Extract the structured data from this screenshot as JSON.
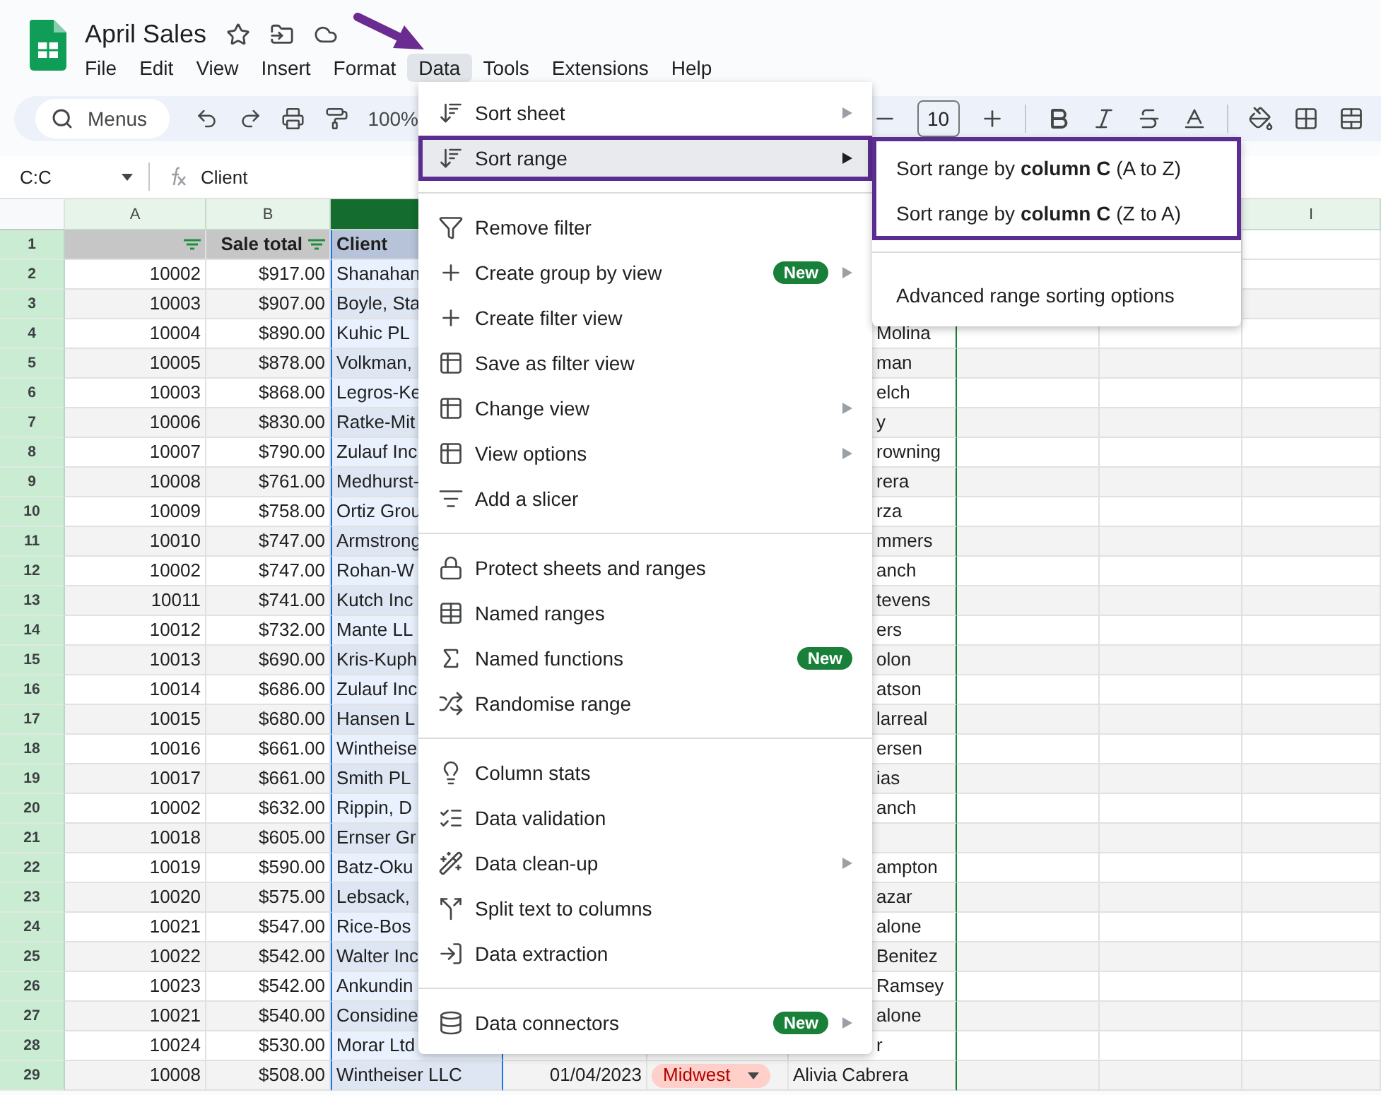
{
  "document": {
    "title": "April Sales"
  },
  "menubar": {
    "items": [
      {
        "label": "File",
        "selected": false
      },
      {
        "label": "Edit",
        "selected": false
      },
      {
        "label": "View",
        "selected": false
      },
      {
        "label": "Insert",
        "selected": false
      },
      {
        "label": "Format",
        "selected": false
      },
      {
        "label": "Data",
        "selected": true
      },
      {
        "label": "Tools",
        "selected": false
      },
      {
        "label": "Extensions",
        "selected": false
      },
      {
        "label": "Help",
        "selected": false
      }
    ]
  },
  "toolbar": {
    "search": {
      "placeholder": "Menus"
    },
    "zoom": "100%",
    "font_size": "10"
  },
  "formula_bar": {
    "name_box": "C:C",
    "content": "Client"
  },
  "sheet": {
    "column_headers": [
      {
        "label": "A",
        "selected": false
      },
      {
        "label": "B",
        "selected": false
      },
      {
        "selected": true
      },
      {
        "label": "I",
        "selected": false
      }
    ],
    "header_row": {
      "number": "1",
      "cells": [
        {
          "filter": true
        },
        {
          "text": "Sale total",
          "filter": true
        },
        {
          "text": "Client",
          "filter": false
        }
      ]
    },
    "rows": [
      {
        "number": "2",
        "a": "10002",
        "b": "$917.00",
        "c": "Shanahan"
      },
      {
        "number": "3",
        "a": "10003",
        "b": "$907.00",
        "c": "Boyle, Sta"
      },
      {
        "number": "4",
        "a": "10004",
        "b": "$890.00",
        "c": "Kuhic PL",
        "f_visible": "Molina"
      },
      {
        "number": "5",
        "a": "10005",
        "b": "$878.00",
        "c": "Volkman,",
        "f_visible": "man"
      },
      {
        "number": "6",
        "a": "10003",
        "b": "$868.00",
        "c": "Legros-Ke",
        "f_visible": "elch"
      },
      {
        "number": "7",
        "a": "10006",
        "b": "$830.00",
        "c": "Ratke-Mit",
        "f_visible": "y"
      },
      {
        "number": "8",
        "a": "10007",
        "b": "$790.00",
        "c": "Zulauf Inc",
        "f_visible": "rowning"
      },
      {
        "number": "9",
        "a": "10008",
        "b": "$761.00",
        "c": "Medhurst-",
        "f_visible": "rera"
      },
      {
        "number": "10",
        "a": "10009",
        "b": "$758.00",
        "c": "Ortiz Grou",
        "f_visible": "rza"
      },
      {
        "number": "11",
        "a": "10010",
        "b": "$747.00",
        "c": "Armstrong",
        "f_visible": "mmers"
      },
      {
        "number": "12",
        "a": "10002",
        "b": "$747.00",
        "c": "Rohan-W",
        "f_visible": "anch"
      },
      {
        "number": "13",
        "a": "10011",
        "b": "$741.00",
        "c": "Kutch Inc",
        "f_visible": "tevens"
      },
      {
        "number": "14",
        "a": "10012",
        "b": "$732.00",
        "c": "Mante LL",
        "f_visible": "ers"
      },
      {
        "number": "15",
        "a": "10013",
        "b": "$690.00",
        "c": "Kris-Kuph",
        "f_visible": "olon"
      },
      {
        "number": "16",
        "a": "10014",
        "b": "$686.00",
        "c": "Zulauf Inc",
        "f_visible": "atson"
      },
      {
        "number": "17",
        "a": "10015",
        "b": "$680.00",
        "c": "Hansen L",
        "f_visible": "larreal"
      },
      {
        "number": "18",
        "a": "10016",
        "b": "$661.00",
        "c": "Wintheise",
        "f_visible": "ersen"
      },
      {
        "number": "19",
        "a": "10017",
        "b": "$661.00",
        "c": "Smith PL",
        "f_visible": "ias"
      },
      {
        "number": "20",
        "a": "10002",
        "b": "$632.00",
        "c": "Rippin, D",
        "f_visible": "anch"
      },
      {
        "number": "21",
        "a": "10018",
        "b": "$605.00",
        "c": "Ernser Gr"
      },
      {
        "number": "22",
        "a": "10019",
        "b": "$590.00",
        "c": "Batz-Oku",
        "f_visible": "ampton"
      },
      {
        "number": "23",
        "a": "10020",
        "b": "$575.00",
        "c": "Lebsack,",
        "f_visible": "azar"
      },
      {
        "number": "24",
        "a": "10021",
        "b": "$547.00",
        "c": "Rice-Bos",
        "f_visible": "alone"
      },
      {
        "number": "25",
        "a": "10022",
        "b": "$542.00",
        "c": "Walter Inc",
        "f_visible": "Benitez"
      },
      {
        "number": "26",
        "a": "10023",
        "b": "$542.00",
        "c": "Ankundin",
        "f_visible": "Ramsey"
      },
      {
        "number": "27",
        "a": "10021",
        "b": "$540.00",
        "c": "Considine",
        "f_visible": "alone"
      },
      {
        "number": "28",
        "a": "10024",
        "b": "$530.00",
        "c": "Morar Ltd",
        "f_visible": "r"
      },
      {
        "number": "29",
        "a": "10008",
        "b": "$508.00",
        "c": "Wintheiser LLC",
        "d": "01/04/2023",
        "e_chip": "Midwest",
        "f": "Alivia Cabrera"
      }
    ]
  },
  "menu": {
    "groups": [
      {
        "items": [
          {
            "label": "Sort sheet",
            "submenu": true,
            "selected": false,
            "annotated": false
          },
          {
            "label": "Sort range",
            "submenu": true,
            "selected": true,
            "annotated": true
          }
        ]
      },
      {
        "items": [
          {
            "label": "Remove filter",
            "submenu": false,
            "selected": false,
            "annotated": false
          },
          {
            "label": "Create group by view",
            "badge": "New",
            "submenu": true,
            "selected": false,
            "annotated": false
          },
          {
            "label": "Create filter view",
            "submenu": false,
            "selected": false,
            "annotated": false
          },
          {
            "label": "Save as filter view",
            "submenu": false,
            "selected": false,
            "annotated": false
          },
          {
            "label": "Change view",
            "submenu": true,
            "selected": false,
            "annotated": false
          },
          {
            "label": "View options",
            "submenu": true,
            "selected": false,
            "annotated": false
          },
          {
            "label": "Add a slicer",
            "submenu": false,
            "selected": false,
            "annotated": false
          }
        ]
      },
      {
        "items": [
          {
            "label": "Protect sheets and ranges",
            "submenu": false,
            "selected": false,
            "annotated": false
          },
          {
            "label": "Named ranges",
            "submenu": false,
            "selected": false,
            "annotated": false
          },
          {
            "label": "Named functions",
            "badge": "New",
            "submenu": false,
            "selected": false,
            "annotated": false
          },
          {
            "label": "Randomise range",
            "submenu": false,
            "selected": false,
            "annotated": false
          }
        ]
      },
      {
        "items": [
          {
            "label": "Column stats",
            "submenu": false,
            "selected": false,
            "annotated": false
          },
          {
            "label": "Data validation",
            "submenu": false,
            "selected": false,
            "annotated": false
          },
          {
            "label": "Data clean-up",
            "submenu": true,
            "selected": false,
            "annotated": false
          },
          {
            "label": "Split text to columns",
            "submenu": false,
            "selected": false,
            "annotated": false
          },
          {
            "label": "Data extraction",
            "submenu": false,
            "selected": false,
            "annotated": false
          }
        ]
      },
      {
        "items": [
          {
            "label": "Data connectors",
            "badge": "New",
            "submenu": true,
            "selected": false,
            "annotated": false
          }
        ]
      }
    ]
  },
  "submenu": {
    "groups": [
      {
        "annotated": true,
        "items": [
          "Sort range by **column C** (A to Z)",
          "Sort range by **column C** (Z to A)"
        ]
      },
      {
        "annotated": false,
        "items": [
          "Advanced range sorting options"
        ]
      }
    ]
  }
}
